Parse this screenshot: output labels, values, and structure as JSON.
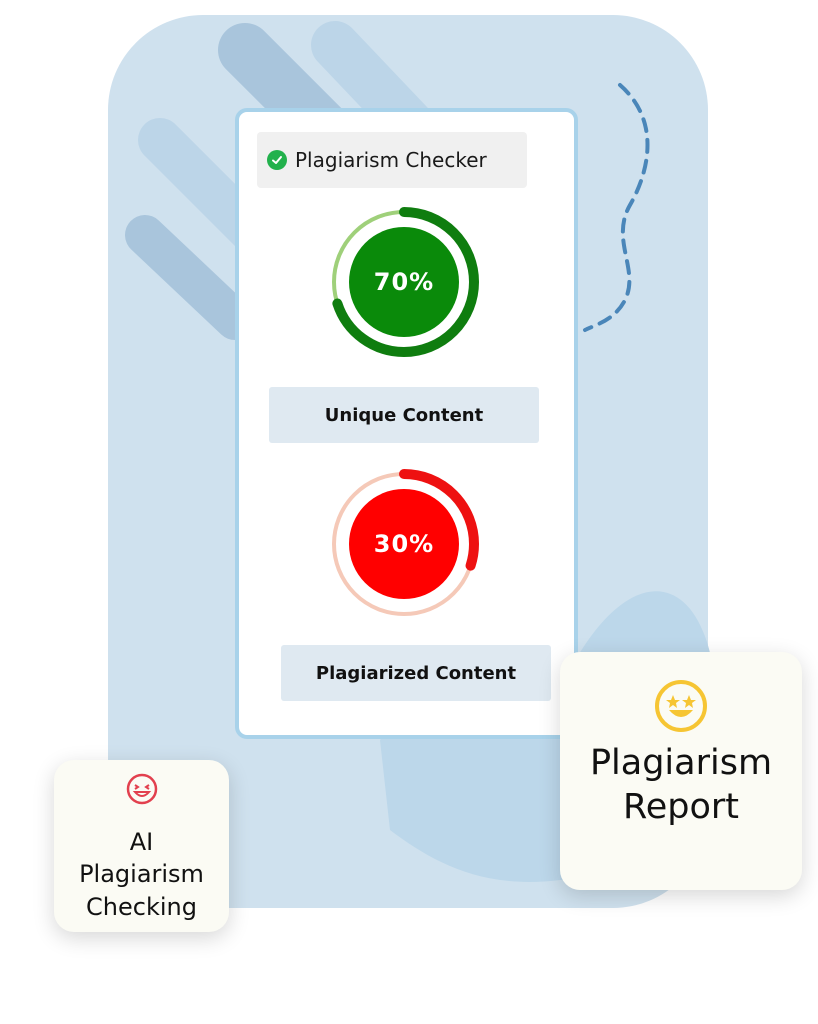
{
  "app": {
    "title": "Plagiarism Checker",
    "title_icon": "check-circle-icon"
  },
  "results": [
    {
      "key": "unique",
      "percent_text": "70%",
      "value": 0.7,
      "label": "Unique Content",
      "fill_color": "#0a8a0a",
      "ring_color": "#0f7d0f",
      "track_color": "#9fd07a"
    },
    {
      "key": "plagiarized",
      "percent_text": "30%",
      "value": 0.3,
      "label": "Plagiarized Content",
      "fill_color": "#ff0000",
      "ring_color": "#ee1111",
      "track_color": "#f5c9b8"
    }
  ],
  "cards": {
    "ai_checking": {
      "icon": "laughing-face-icon",
      "text": "AI Plagiarism Checking"
    },
    "report": {
      "icon": "star-eyes-face-icon",
      "text": "Plagiarism Report"
    }
  },
  "colors": {
    "blob": "#cfe1ee",
    "stripe": "#b8d4e8",
    "dash": "#4a86b9"
  }
}
